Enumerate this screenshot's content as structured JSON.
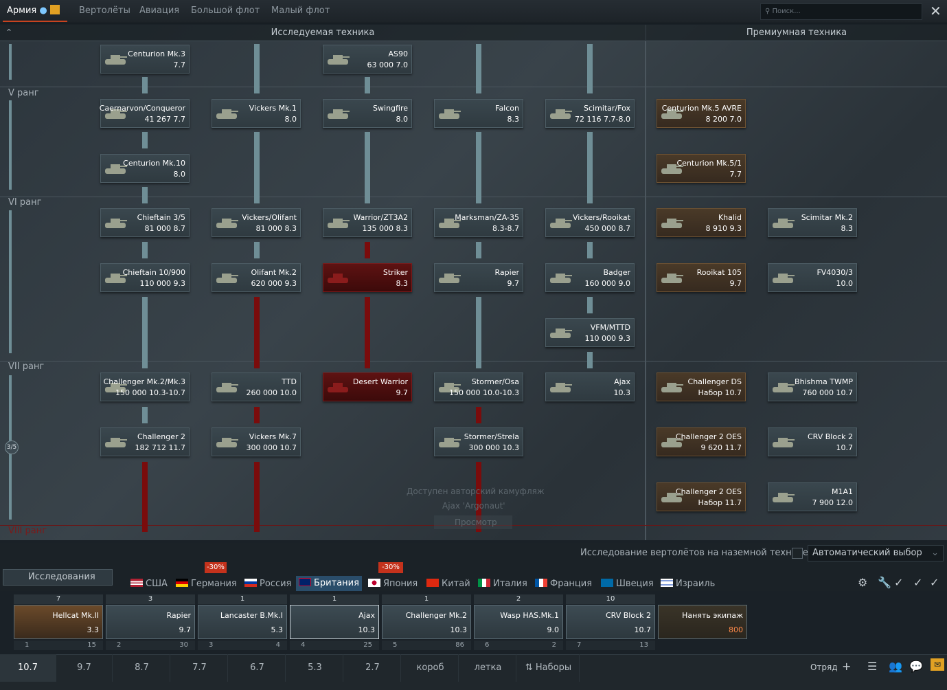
{
  "topbar": {
    "tabs": [
      {
        "label": "Армия",
        "active": true
      },
      {
        "label": "Вертолёты",
        "active": false
      },
      {
        "label": "Авиация",
        "active": false
      },
      {
        "label": "Большой флот",
        "active": false
      },
      {
        "label": "Малый флот",
        "active": false
      }
    ],
    "search_placeholder": "Поиск..."
  },
  "tree": {
    "researched_header": "Исследуемая техника",
    "premium_header": "Премиумная техника",
    "ranks": [
      "V ранг",
      "VI ранг",
      "VII ранг",
      "VIII ранг"
    ],
    "rank_progress": "3/5",
    "cards": [
      {
        "name": "Centurion Mk.3",
        "stats": "7.7"
      },
      {
        "name": "AS90",
        "stats": "63 000 7.0"
      },
      {
        "name": "Caernarvon/Conqueror",
        "stats": "41 267 7.7"
      },
      {
        "name": "Vickers Mk.1",
        "stats": "8.0"
      },
      {
        "name": "Swingfire",
        "stats": "8.0"
      },
      {
        "name": "Falcon",
        "stats": "8.3"
      },
      {
        "name": "Scimitar/Fox",
        "stats": "72 116 7.7-8.0"
      },
      {
        "name": "Centurion Mk.5 AVRE",
        "stats": "8 200 7.0"
      },
      {
        "name": "Centurion Mk.10",
        "stats": "8.0"
      },
      {
        "name": "Centurion Mk.5/1",
        "stats": "7.7"
      },
      {
        "name": "Chieftain 3/5",
        "stats": "81 000 8.7"
      },
      {
        "name": "Vickers/Olifant",
        "stats": "81 000 8.3"
      },
      {
        "name": "Warrior/ZT3A2",
        "stats": "135 000 8.3"
      },
      {
        "name": "Marksman/ZA-35",
        "stats": "8.3-8.7"
      },
      {
        "name": "Vickers/Rooikat",
        "stats": "450 000 8.7"
      },
      {
        "name": "Khalid",
        "stats": "8 910 9.3"
      },
      {
        "name": "Scimitar Mk.2",
        "stats": "8.3"
      },
      {
        "name": "Chieftain 10/900",
        "stats": "110 000 9.3"
      },
      {
        "name": "Olifant Mk.2",
        "stats": "620 000 9.3"
      },
      {
        "name": "Striker",
        "stats": "8.3"
      },
      {
        "name": "Rapier",
        "stats": "9.7"
      },
      {
        "name": "Badger",
        "stats": "160 000 9.0"
      },
      {
        "name": "Rooikat 105",
        "stats": "9.7"
      },
      {
        "name": "FV4030/3",
        "stats": "10.0"
      },
      {
        "name": "VFM/MTTD",
        "stats": "110 000 9.3"
      },
      {
        "name": "Challenger Mk.2/Mk.3",
        "stats": "150 000 10.3-10.7"
      },
      {
        "name": "TTD",
        "stats": "260 000 10.0"
      },
      {
        "name": "Desert Warrior",
        "stats": "9.7"
      },
      {
        "name": "Stormer/Osa",
        "stats": "150 000 10.0-10.3"
      },
      {
        "name": "Ajax",
        "stats": "10.3"
      },
      {
        "name": "Challenger DS",
        "stats": "Набор 10.7"
      },
      {
        "name": "Bhishma TWMP",
        "stats": "760 000 10.7"
      },
      {
        "name": "Challenger 2",
        "stats": "182 712 11.7"
      },
      {
        "name": "Vickers Mk.7",
        "stats": "300 000 10.7"
      },
      {
        "name": "Stormer/Strela",
        "stats": "300 000 10.3"
      },
      {
        "name": "Challenger 2 OES",
        "stats": "9 620 11.7"
      },
      {
        "name": "CRV Block 2",
        "stats": "10.7"
      },
      {
        "name": "Challenger 2 OES",
        "stats": "Набор 11.7"
      },
      {
        "name": "M1A1",
        "stats": "7 900 12.0"
      }
    ],
    "overlay": [
      "Доступен авторский камуфляж",
      "Ajax 'Argonaut'",
      "Просмотр"
    ]
  },
  "controls": {
    "research_label": "Исследования",
    "heli_research": "Исследование вертолётов на наземной технике",
    "auto_select": "Автоматический выбор",
    "nations": [
      {
        "label": "США",
        "badge": ""
      },
      {
        "label": "Германия",
        "badge": "-30%"
      },
      {
        "label": "Россия",
        "badge": ""
      },
      {
        "label": "Британия",
        "badge": "",
        "active": true
      },
      {
        "label": "Япония",
        "badge": "-30%"
      },
      {
        "label": "Китай",
        "badge": ""
      },
      {
        "label": "Италия",
        "badge": ""
      },
      {
        "label": "Франция",
        "badge": ""
      },
      {
        "label": "Швеция",
        "badge": ""
      },
      {
        "label": "Израиль",
        "badge": ""
      }
    ]
  },
  "crew": [
    {
      "count": "7",
      "name": "Hellcat Mk.II",
      "br": "3.3",
      "slot": "1",
      "crew": "15"
    },
    {
      "count": "3",
      "name": "Rapier",
      "br": "9.7",
      "slot": "2",
      "crew": "30"
    },
    {
      "count": "1",
      "name": "Lancaster B.Mk.I",
      "br": "5.3",
      "slot": "3",
      "crew": "4"
    },
    {
      "count": "1",
      "name": "Ajax",
      "br": "10.3",
      "slot": "4",
      "crew": "25"
    },
    {
      "count": "1",
      "name": "Challenger Mk.2",
      "br": "10.3",
      "slot": "5",
      "crew": "86"
    },
    {
      "count": "2",
      "name": "Wasp HAS.Mk.1",
      "br": "9.0",
      "slot": "6",
      "crew": "2"
    },
    {
      "count": "10",
      "name": "CRV Block 2",
      "br": "10.7",
      "slot": "7",
      "crew": "13"
    }
  ],
  "hire": {
    "label": "Нанять экипаж",
    "price": "800"
  },
  "bottom": {
    "tabs": [
      "10.7",
      "9.7",
      "8.7",
      "7.7",
      "6.7",
      "5.3",
      "2.7",
      "короб",
      "летка"
    ],
    "presets": "Наборы",
    "squad": "Отряд"
  }
}
